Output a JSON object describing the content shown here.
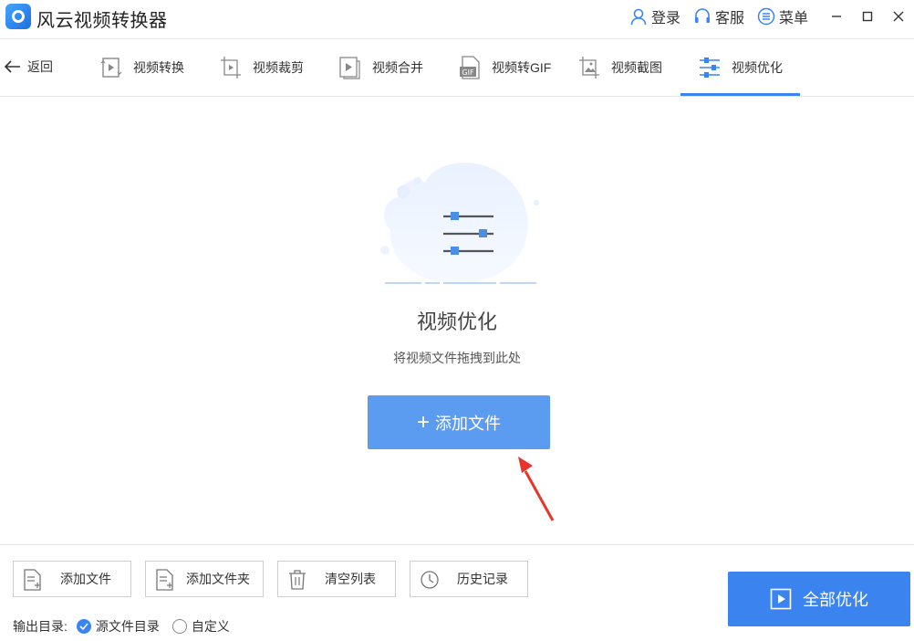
{
  "app": {
    "title": "风云视频转换器",
    "accent_color": "#3b84f0"
  },
  "titlebar": {
    "login_label": "登录",
    "service_label": "客服",
    "menu_label": "菜单",
    "icons": [
      "user-icon",
      "headset-icon",
      "menu-icon",
      "minimize-icon",
      "maximize-icon",
      "close-icon"
    ]
  },
  "tabs": {
    "back_label": "返回",
    "items": [
      {
        "label": "视频转换",
        "icon": "video-convert-icon"
      },
      {
        "label": "视频裁剪",
        "icon": "video-crop-icon"
      },
      {
        "label": "视频合并",
        "icon": "video-merge-icon"
      },
      {
        "label": "视频转GIF",
        "icon": "gif-icon"
      },
      {
        "label": "视频截图",
        "icon": "screenshot-icon"
      },
      {
        "label": "视频优化",
        "icon": "sliders-icon",
        "active": true
      }
    ],
    "gif_badge": "GIF"
  },
  "main": {
    "title": "视频优化",
    "subtitle": "将视频文件拖拽到此处",
    "add_file_label": "添加文件",
    "add_file_plus": "+"
  },
  "bottom": {
    "buttons": [
      {
        "label": "添加文件",
        "icon": "file-add-icon"
      },
      {
        "label": "添加文件夹",
        "icon": "folder-add-icon"
      },
      {
        "label": "清空列表",
        "icon": "trash-icon"
      },
      {
        "label": "历史记录",
        "icon": "clock-icon"
      }
    ],
    "output_label": "输出目录:",
    "output_options": [
      {
        "label": "源文件目录",
        "selected": true
      },
      {
        "label": "自定义",
        "selected": false
      }
    ],
    "optimize_all_label": "全部优化"
  }
}
